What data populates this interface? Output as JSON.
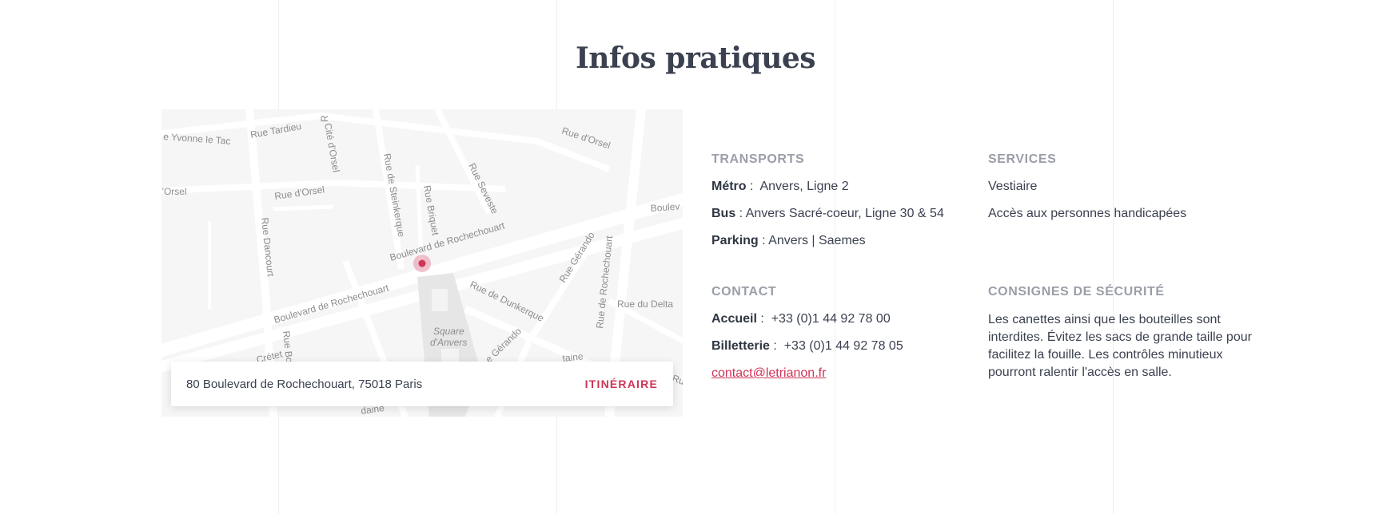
{
  "page": {
    "title": "Infos pratiques"
  },
  "map": {
    "streets": {
      "yvonne": "e Yvonne le Tac",
      "tardieu": "Rue Tardieu",
      "cite_orsel": "Cité d'Orsel",
      "orsel_right": "Rue d'Orsel",
      "orsel_left": "l'Orsel",
      "orsel_mid": "Rue d'Orsel",
      "steinkerque": "Rue de Steinkerque",
      "briquet": "Rue Briquet",
      "seveste": "Rue Seveste",
      "bd_roch_top": "Boulevard de Rochechouart",
      "bd_roch_bottom": "Boulevard de Rochechouart",
      "bd_right": "Boulev",
      "dancourt": "Rue Dancourt",
      "dunkerque": "Rue de Dunkerque",
      "gerando_top": "Rue Gérando",
      "gerando_bottom": "e Gérando",
      "roch_vertical": "Rue de Rochechouart",
      "delta": "Rue du Delta",
      "square": "Square",
      "anvers": "d'Anvers",
      "cretet": "Crétet",
      "rue_bo": "Rue Bo",
      "r_top": "R",
      "taine": "taine",
      "rue_r": "Ru",
      "daine": "daine"
    },
    "address": "80 Boulevard de Rochechouart, 75018 Paris",
    "itinerary_label": "ITINÉRAIRE"
  },
  "transports": {
    "title": "TRANSPORTS",
    "metro_label": "Métro",
    "metro_sep": " :  ",
    "metro_value": "Anvers, Ligne 2",
    "bus_label": "Bus",
    "bus_sep": " : ",
    "bus_value": "Anvers Sacré-coeur, Ligne 30 & 54",
    "parking_label": "Parking",
    "parking_sep": " : ",
    "parking_value": "Anvers | Saemes"
  },
  "contact": {
    "title": "CONTACT",
    "accueil_label": "Accueil",
    "accueil_sep": " :  ",
    "accueil_value": "+33 (0)1 44 92 78 00",
    "billetterie_label": "Billetterie",
    "billetterie_sep": " :  ",
    "billetterie_value": "+33 (0)1 44 92 78 05",
    "email": "contact@letrianon.fr"
  },
  "services": {
    "title": "SERVICES",
    "items": [
      "Vestiaire",
      "Accès aux personnes handicapées"
    ]
  },
  "security": {
    "title": "CONSIGNES DE SÉCURITÉ",
    "text": "Les canettes ainsi que les bouteilles sont interdites. Évitez les sacs de grande taille pour facilitez la fouille. Les contrôles minutieux pourront ralentir l'accès en salle."
  },
  "colors": {
    "accent": "#d03356",
    "heading": "#3b4150",
    "muted": "#9a9ea7"
  }
}
